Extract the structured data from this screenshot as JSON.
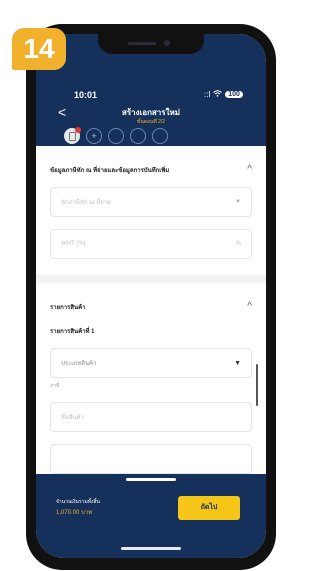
{
  "badge": {
    "step_number": "14",
    "color": "#f2b12c"
  },
  "status_bar": {
    "time": "10:01",
    "signal": "::l",
    "wifi": "wifi",
    "battery": "100"
  },
  "header": {
    "back_label": "<",
    "title": "สร้างเอกสารใหม่",
    "subtitle": "ขั้นตอนที่ 2/2",
    "steps": [
      "",
      "+",
      "",
      "",
      ""
    ]
  },
  "section_tax": {
    "title": "ข้อมูลภาษีหัก ณ ที่จ่ายและข้อมูลการบันทึกเพิ่ม",
    "chevron": "^",
    "withholding_placeholder": "หักภาษีหัก ณ ที่จ่าย",
    "withholding_arrow": "▼",
    "wht_placeholder": "WHT (%)",
    "wht_unit": "%"
  },
  "section_items": {
    "title": "รายการสินค้า",
    "chevron": "^",
    "item_heading": "รายการสินค้าที่ 1",
    "product_type_placeholder": "ประเภทสินค้า",
    "product_type_arrow": "▼",
    "product_type_hint": "ภาษี",
    "product_name_placeholder": "ชื่อสินค้า"
  },
  "footer": {
    "total_label": "จำนวนเงินรวมทั้งสิ้น",
    "total_value": "1,070.00 บาท",
    "next_button": "ถัดไป"
  },
  "colors": {
    "navy": "#15315b",
    "yellow": "#f5c517",
    "accent": "#f2b12c"
  }
}
